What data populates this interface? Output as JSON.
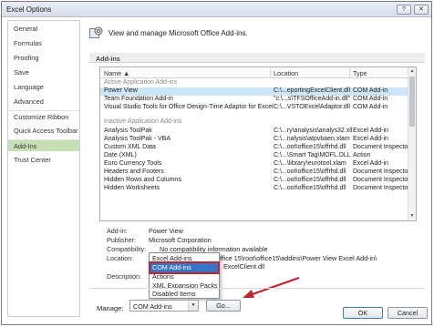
{
  "window": {
    "title": "Excel Options",
    "help_glyph": "?",
    "close_glyph": "✕"
  },
  "sidebar": {
    "items": [
      {
        "label": "General"
      },
      {
        "label": "Formulas"
      },
      {
        "label": "Proofing"
      },
      {
        "label": "Save"
      },
      {
        "label": "Language"
      },
      {
        "label": "Advanced"
      },
      {
        "label": "Customize Ribbon"
      },
      {
        "label": "Quick Access Toolbar"
      },
      {
        "label": "Add-Ins",
        "active": true
      },
      {
        "label": "Trust Center"
      }
    ]
  },
  "main": {
    "header_text": "View and manage Microsoft Office Add-ins.",
    "section_title": "Add-ins",
    "columns": {
      "name": "Name ▲",
      "location": "Location",
      "type": "Type"
    },
    "groups": [
      {
        "heading": "Active Application Add-ins",
        "rows": [
          {
            "name": "Power View",
            "location": "C:\\...eportingExcelClient.dll",
            "type": "COM Add-in",
            "selected": true
          },
          {
            "name": "Team Foundation Add-in",
            "location": "\"c:\\...s\\TFSOfficeAdd-in.dll\"",
            "type": "COM Add-in"
          },
          {
            "name": "Visual Studio Tools for Office Design-Time Adaptor for Excel",
            "location": "C:\\...VSTOExcelAdaptor.dll",
            "type": "COM Add-in"
          }
        ]
      },
      {
        "heading": "Inactive Application Add-ins",
        "rows": [
          {
            "name": "Analysis ToolPak",
            "location": "C:\\...ry\\analysis\\analys32.xll",
            "type": "Excel Add-in"
          },
          {
            "name": "Analysis ToolPak - VBA",
            "location": "C:\\...nalysis\\atpvbaen.xlam",
            "type": "Excel Add-in"
          },
          {
            "name": "Custom XML Data",
            "location": "C:\\...oot\\office15\\offrhd.dll",
            "type": "Document Inspector"
          },
          {
            "name": "Date (XML)",
            "location": "C:\\...\\Smart Tag\\MOFL.DLL",
            "type": "Action"
          },
          {
            "name": "Euro Currency Tools",
            "location": "C:\\...\\library\\eurotool.xlam",
            "type": "Excel Add-in"
          },
          {
            "name": "Headers and Footers",
            "location": "C:\\...oot\\office15\\offrhd.dll",
            "type": "Document Inspector"
          },
          {
            "name": "Hidden Rows and Columns",
            "location": "C:\\...oot\\office15\\offrhd.dll",
            "type": "Document Inspector"
          },
          {
            "name": "Hidden Worksheets",
            "location": "C:\\...oot\\office15\\offrhd.dll",
            "type": "Document Inspector"
          }
        ]
      }
    ],
    "details": {
      "addin_label": "Add-in:",
      "addin_value": "Power View",
      "publisher_label": "Publisher:",
      "publisher_value": "Microsoft Corporation",
      "compat_label": "Compatibility:",
      "compat_value": "No compatibility information available",
      "location_label": "Location:",
      "location_value": "Microsoft Office 15\\root\\office15\\addins\\Power View Excel Add-in\\",
      "location_value2": "ExcelClient.dll",
      "description_label": "Description:"
    },
    "dropdown_menu": [
      {
        "label": "Excel Add-ins"
      },
      {
        "label": "COM Add-ins",
        "highlighted": true
      },
      {
        "label": "Actions"
      },
      {
        "label": "XML Expansion Packs"
      },
      {
        "label": "Disabled Items"
      }
    ],
    "manage": {
      "label": "Manage:",
      "value": "COM Add-ins",
      "go_label": "Go..."
    }
  },
  "footer": {
    "ok_label": "OK",
    "cancel_label": "Cancel"
  },
  "colors": {
    "accent_selected": "#3874c8",
    "sidebar_active": "#c6dfb4",
    "annotation_red": "#c0252a"
  }
}
